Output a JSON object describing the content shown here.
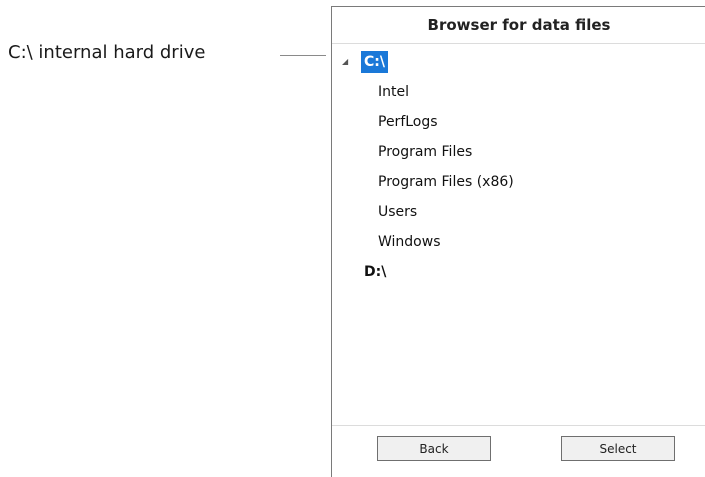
{
  "callout": {
    "label": "C:\\ internal hard drive"
  },
  "browser": {
    "title": "Browser for data files",
    "tree": {
      "drives": [
        {
          "label": "C:\\",
          "expanded": true,
          "selected": true,
          "expander_icon": "triangle-expanded-icon",
          "folders": [
            "Intel",
            "PerfLogs",
            "Program Files",
            "Program Files (x86)",
            "Users",
            "Windows"
          ]
        },
        {
          "label": "D:\\",
          "expanded": false,
          "selected": false
        }
      ]
    },
    "buttons": {
      "back_label": "Back",
      "select_label": "Select"
    }
  },
  "colors": {
    "selection_bg": "#1a78d8",
    "selection_fg": "#ffffff"
  }
}
